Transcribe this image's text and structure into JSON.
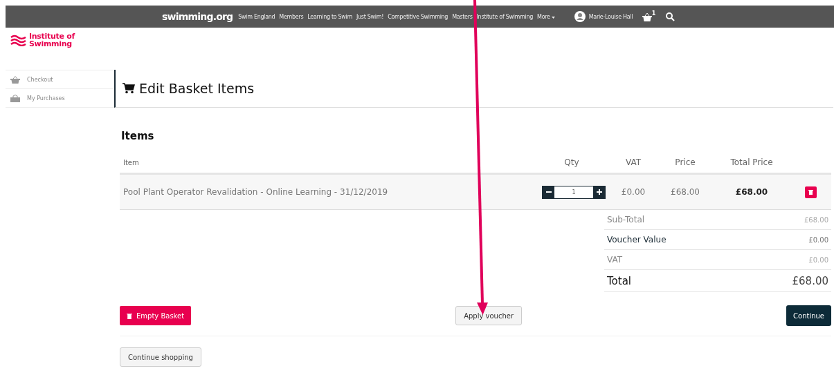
{
  "top_bar": {
    "brand": "swimming.org",
    "links": [
      "Swim England",
      "Members",
      "Learning to Swim",
      "Just Swim!",
      "Competitive Swimming",
      "Masters",
      "Institute of Swimming",
      "More"
    ],
    "user": "Marie-Louise Hall",
    "basket_count": "1"
  },
  "logo": {
    "line1": "Institute of",
    "line2": "Swimming"
  },
  "sidebar": {
    "items": [
      {
        "label": "Checkout",
        "kind": "basket"
      },
      {
        "label": "My Purchases",
        "kind": "bag"
      }
    ]
  },
  "page_title": "Edit Basket Items",
  "section_title": "Items",
  "table": {
    "columns": [
      "Item",
      "Qty",
      "VAT",
      "Price",
      "Total Price"
    ],
    "rows": [
      {
        "item": "Pool Plant Operator Revalidation - Online Learning - 31/12/2019",
        "qty": "1",
        "vat": "£0.00",
        "price": "£68.00",
        "total": "£68.00"
      }
    ]
  },
  "summary": [
    {
      "label": "Sub-Total",
      "value": "£68.00",
      "kind": "muted"
    },
    {
      "label": "Voucher Value",
      "value": "£0.00",
      "kind": "dark"
    },
    {
      "label": "VAT",
      "value": "£0.00",
      "kind": "muted"
    },
    {
      "label": "Total",
      "value": "£68.00",
      "kind": "total"
    }
  ],
  "buttons": {
    "empty": "Empty Basket",
    "voucher": "Apply voucher",
    "continue": "Continue",
    "shopping": "Continue shopping"
  }
}
